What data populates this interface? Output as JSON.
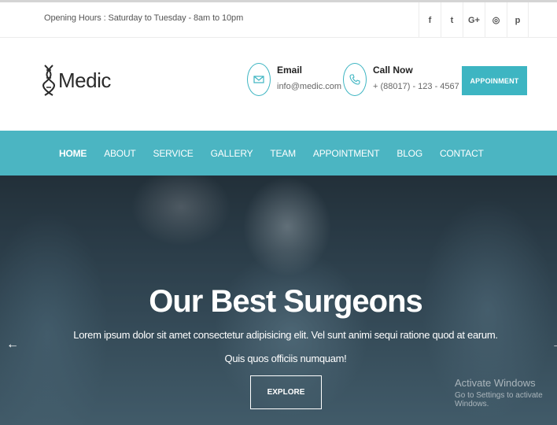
{
  "topbar": {
    "hours": "Opening Hours : Saturday to Tuesday - 8am to 10pm",
    "social": [
      {
        "icon": "facebook-icon",
        "glyph": "f"
      },
      {
        "icon": "twitter-icon",
        "glyph": "t"
      },
      {
        "icon": "google-plus-icon",
        "glyph": "G+"
      },
      {
        "icon": "instagram-icon",
        "glyph": "◎"
      },
      {
        "icon": "pinterest-icon",
        "glyph": "p"
      }
    ]
  },
  "header": {
    "logo_text": "Medic",
    "email_title": "Email",
    "email_value": "info@medic.com",
    "call_title": "Call Now",
    "call_value": "+ (88017) - 123 - 4567",
    "appointment_label": "APPOINMENT"
  },
  "nav": {
    "items": [
      "HOME",
      "ABOUT",
      "SERVICE",
      "GALLERY",
      "TEAM",
      "APPOINTMENT",
      "BLOG",
      "CONTACT"
    ]
  },
  "hero": {
    "title": "Our Best Surgeons",
    "line1": "Lorem ipsum dolor sit amet consectetur adipisicing elit. Vel sunt animi sequi ratione quod at earum.",
    "line2": "Quis quos officiis numquam!",
    "explore_label": "EXPLORE",
    "prev_arrow": "←",
    "next_arrow": "→"
  },
  "watermark": {
    "line1": "Activate Windows",
    "line2": "Go to Settings to activate Windows."
  },
  "colors": {
    "accent": "#4bb5c2"
  }
}
